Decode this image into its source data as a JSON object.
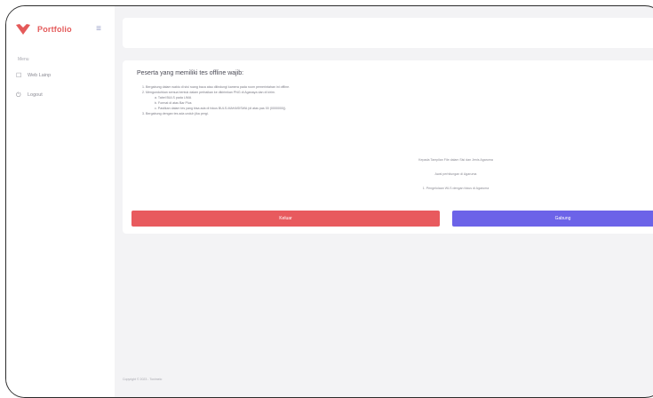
{
  "brand": {
    "name": "Portfolio",
    "logo_color": "#e45a5a"
  },
  "sidebar": {
    "section_label": "Menu",
    "items": [
      {
        "icon": "square-icon",
        "label": "Web Lainp"
      },
      {
        "icon": "logout-icon",
        "label": "Logout"
      }
    ]
  },
  "card": {
    "title": "Peserta yang memiliki tes offline wajib:",
    "rules": [
      "1. Bergabung dalam waktu di sisi ruang baca atau dilindungi kamera pada room pemerintahan ini offline.",
      "2. Mengunduhkan semua bentuk dalam perbaikan ke dikirimkan PNG di Aganaya dan di kirim.",
      "a. Tabel BULS pada LIMA",
      "b. Format di atas Bar Plus",
      "c. Pastikan dalam tes yang bisa ada di fokus BULS-MAHASISWA (di atas pas 00 (0000000)).",
      "3. Bergabung dengan tes ada unduh jika pergi."
    ],
    "center_lines": [
      "Kepada Tampilan File dalam Sisi dan Jenis Agaruma",
      "Awal perhitungan di Agaruma",
      "1. Pengelolaan WLS dengan fokus di Agaruma"
    ],
    "exit_label": "Keluar",
    "join_label": "Gabung"
  },
  "footer": {
    "text": "Copyright © 2023 - Tonimelo"
  },
  "colors": {
    "exit": "#e85a5e",
    "join": "#6c63e8",
    "background": "#f3f3f5"
  }
}
